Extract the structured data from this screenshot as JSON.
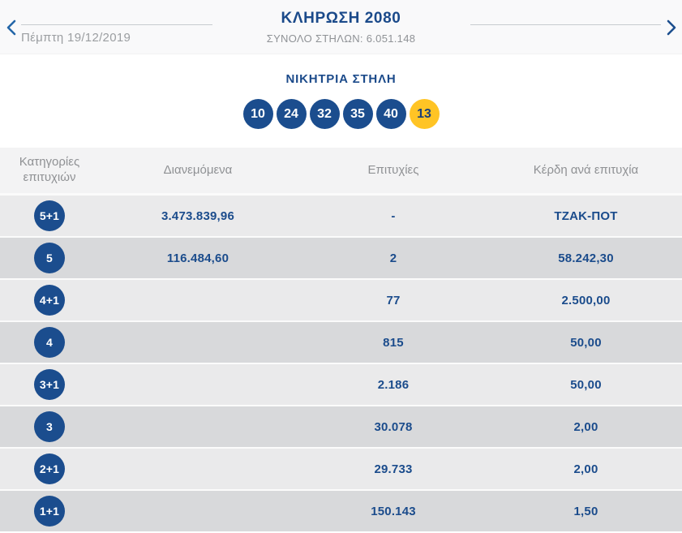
{
  "header": {
    "title": "ΚΛΗΡΩΣΗ 2080",
    "total_columns": "ΣΥΝΟΛΟ ΣΤΗΛΩΝ: 6.051.148",
    "date": "Πέμπτη 19/12/2019",
    "prev_icon": "chevron-left",
    "next_icon": "chevron-right"
  },
  "winning_column": {
    "title": "ΝΙΚΗΤΡΙΑ ΣΤΗΛΗ",
    "numbers": [
      {
        "value": "10",
        "type": "main"
      },
      {
        "value": "24",
        "type": "main"
      },
      {
        "value": "32",
        "type": "main"
      },
      {
        "value": "35",
        "type": "main"
      },
      {
        "value": "40",
        "type": "main"
      },
      {
        "value": "13",
        "type": "bonus"
      }
    ]
  },
  "results_table": {
    "columns": [
      "Κατηγορίες επιτυχιών",
      "Διανεμόμενα",
      "Επιτυχίες",
      "Κέρδη ανά επιτυχία"
    ],
    "rows": [
      {
        "category": "5+1",
        "distributed": "3.473.839,96",
        "winners": "-",
        "prize": "ΤΖΑΚ-ΠΟΤ"
      },
      {
        "category": "5",
        "distributed": "116.484,60",
        "winners": "2",
        "prize": "58.242,30"
      },
      {
        "category": "4+1",
        "distributed": "",
        "winners": "77",
        "prize": "2.500,00"
      },
      {
        "category": "4",
        "distributed": "",
        "winners": "815",
        "prize": "50,00"
      },
      {
        "category": "3+1",
        "distributed": "",
        "winners": "2.186",
        "prize": "50,00"
      },
      {
        "category": "3",
        "distributed": "",
        "winners": "30.078",
        "prize": "2,00"
      },
      {
        "category": "2+1",
        "distributed": "",
        "winners": "29.733",
        "prize": "2,00"
      },
      {
        "category": "1+1",
        "distributed": "",
        "winners": "150.143",
        "prize": "1,50"
      }
    ]
  },
  "colors": {
    "navy": "#1b4d8e",
    "bonus_yellow": "#ffc425",
    "row_light": "#eaeaeb",
    "row_dark": "#d8d9db",
    "muted_text": "#8f9296"
  }
}
